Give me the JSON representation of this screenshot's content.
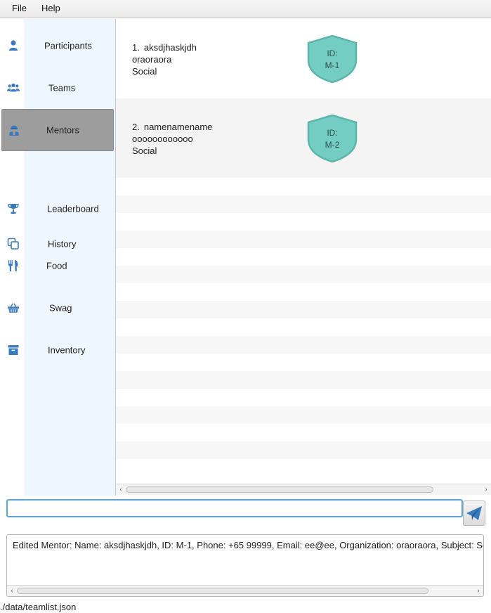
{
  "menu": {
    "file": "File",
    "help": "Help"
  },
  "sidebar": {
    "items": [
      {
        "label": "Participants",
        "icon": "user-icon"
      },
      {
        "label": "Teams",
        "icon": "users-icon"
      },
      {
        "label": "Mentors",
        "icon": "mentor-icon",
        "active": true
      },
      {
        "label": "Leaderboard",
        "icon": "trophy-icon"
      },
      {
        "label": "History",
        "icon": "copy-icon"
      },
      {
        "label": "Food",
        "icon": "utensils-icon"
      },
      {
        "label": "Swag",
        "icon": "basket-icon"
      },
      {
        "label": "Inventory",
        "icon": "archive-icon"
      }
    ]
  },
  "mentors": [
    {
      "index": "1.",
      "name": "aksdjhaskjdh",
      "organization": "oraoraora",
      "subject": "Social",
      "id_label": "ID:",
      "id": "M-1"
    },
    {
      "index": "2.",
      "name": "namenamename",
      "organization": "oooooooooooo",
      "subject": "Social",
      "id_label": "ID:",
      "id": "M-2"
    }
  ],
  "command": {
    "value": ""
  },
  "result": {
    "text": "Edited Mentor:  Name: aksdjhaskjdh, ID: M-1, Phone: +65 99999, Email: ee@ee, Organization: oraoraora, Subject: Social"
  },
  "status": {
    "file_path": "./data/teamlist.json"
  },
  "colors": {
    "accent": "#3a7bbf",
    "active_nav": "#9d9d9d",
    "badge_fill": "#74cdc2",
    "input_border": "#5aa6dd"
  }
}
